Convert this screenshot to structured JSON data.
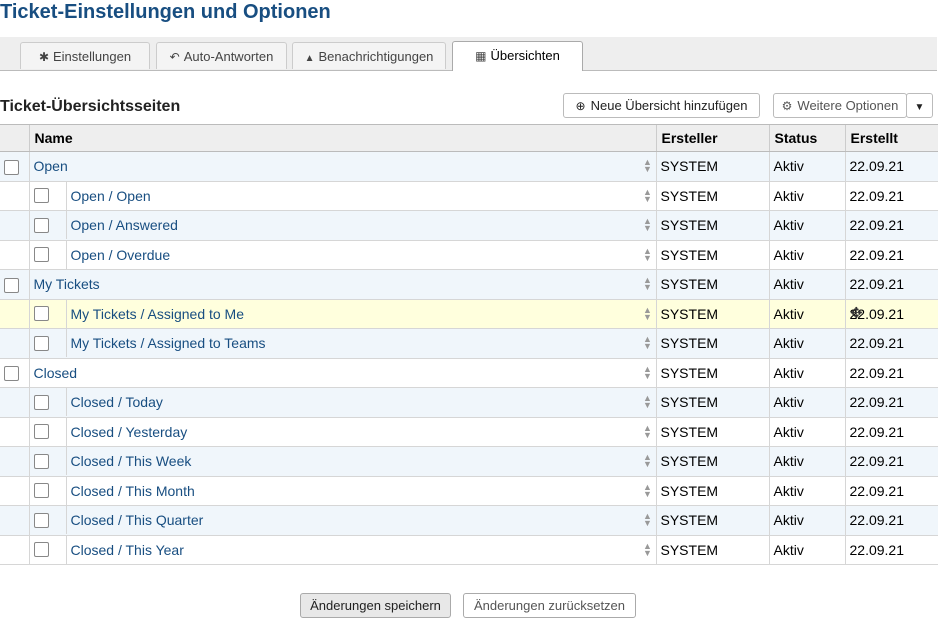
{
  "page": {
    "title": "Ticket-Einstellungen und Optionen"
  },
  "tabs": [
    {
      "label": "Einstellungen",
      "icon": "asterisk-icon",
      "glyph": "✱"
    },
    {
      "label": "Auto-Antworten",
      "icon": "reply-icon",
      "glyph": "↶"
    },
    {
      "label": "Benachrichtigungen",
      "icon": "bell-icon",
      "glyph": "🔔"
    },
    {
      "label": "Übersichten",
      "icon": "table-icon",
      "glyph": "▦",
      "active": true
    }
  ],
  "section": {
    "title": "Ticket-Übersichtsseiten",
    "add_button": "Neue Übersicht hinzufügen",
    "more_button": "Weitere Optionen"
  },
  "table": {
    "headers": {
      "name": "Name",
      "creator": "Ersteller",
      "status": "Status",
      "created": "Erstellt"
    },
    "rows": [
      {
        "name": "Open",
        "level": 0,
        "creator": "SYSTEM",
        "status": "Aktiv",
        "created": "22.09.21"
      },
      {
        "name": "Open / Open",
        "level": 1,
        "creator": "SYSTEM",
        "status": "Aktiv",
        "created": "22.09.21"
      },
      {
        "name": "Open / Answered",
        "level": 1,
        "creator": "SYSTEM",
        "status": "Aktiv",
        "created": "22.09.21"
      },
      {
        "name": "Open / Overdue",
        "level": 1,
        "creator": "SYSTEM",
        "status": "Aktiv",
        "created": "22.09.21"
      },
      {
        "name": "My Tickets",
        "level": 0,
        "creator": "SYSTEM",
        "status": "Aktiv",
        "created": "22.09.21"
      },
      {
        "name": "My Tickets / Assigned to Me",
        "level": 1,
        "creator": "SYSTEM",
        "status": "Aktiv",
        "created": "22.09.21",
        "highlight": true
      },
      {
        "name": "My Tickets / Assigned to Teams",
        "level": 1,
        "creator": "SYSTEM",
        "status": "Aktiv",
        "created": "22.09.21"
      },
      {
        "name": "Closed",
        "level": 0,
        "creator": "SYSTEM",
        "status": "Aktiv",
        "created": "22.09.21"
      },
      {
        "name": "Closed / Today",
        "level": 1,
        "creator": "SYSTEM",
        "status": "Aktiv",
        "created": "22.09.21"
      },
      {
        "name": "Closed / Yesterday",
        "level": 1,
        "creator": "SYSTEM",
        "status": "Aktiv",
        "created": "22.09.21"
      },
      {
        "name": "Closed / This Week",
        "level": 1,
        "creator": "SYSTEM",
        "status": "Aktiv",
        "created": "22.09.21"
      },
      {
        "name": "Closed / This Month",
        "level": 1,
        "creator": "SYSTEM",
        "status": "Aktiv",
        "created": "22.09.21"
      },
      {
        "name": "Closed / This Quarter",
        "level": 1,
        "creator": "SYSTEM",
        "status": "Aktiv",
        "created": "22.09.21"
      },
      {
        "name": "Closed / This Year",
        "level": 1,
        "creator": "SYSTEM",
        "status": "Aktiv",
        "created": "22.09.21"
      }
    ]
  },
  "footer": {
    "save_button": "Änderungen speichern",
    "reset_button": "Änderungen zurücksetzen"
  },
  "colors": {
    "title": "#184e81",
    "link": "#184e81",
    "row_alt": "#f0f6fb",
    "row_highlight": "#ffffdd"
  }
}
